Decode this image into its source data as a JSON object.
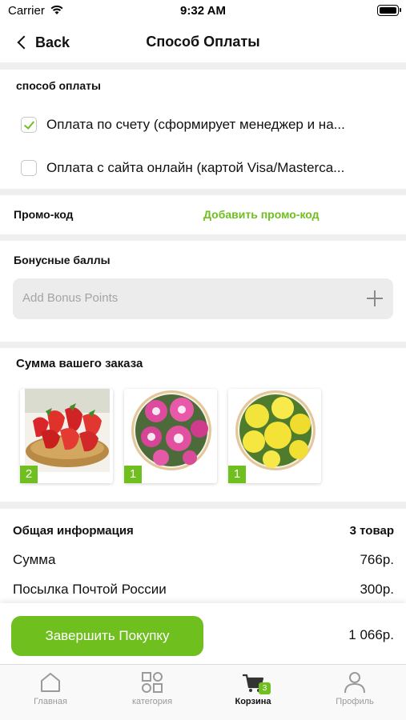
{
  "status_bar": {
    "carrier": "Carrier",
    "time": "9:32 AM"
  },
  "nav": {
    "back_label": "Back",
    "title": "Способ Оплаты"
  },
  "payment": {
    "section_label": "способ оплаты",
    "options": [
      {
        "label": "Оплата по счету (сформирует менеджер и на...",
        "checked": true
      },
      {
        "label": "Оплата с сайта онлайн (картой Visa/Masterca...",
        "checked": false
      }
    ]
  },
  "promo": {
    "label": "Промо-код",
    "link": "Добавить промо-код"
  },
  "bonus": {
    "label": "Бонусные баллы",
    "placeholder": "Add Bonus Points"
  },
  "order": {
    "title": "Сумма вашего заказа",
    "items": [
      {
        "quantity": "2",
        "image": "strawberries"
      },
      {
        "quantity": "1",
        "image": "pink-asters"
      },
      {
        "quantity": "1",
        "image": "yellow-asters"
      }
    ]
  },
  "summary": {
    "title": "Общая информация",
    "count": "3 товар",
    "rows": [
      {
        "label": "Сумма",
        "value": "766р."
      },
      {
        "label": "Посылка Почтой России",
        "value": "300р."
      }
    ]
  },
  "checkout": {
    "button_label": "Завершить Покупку",
    "total": "1 066р."
  },
  "tabbar": {
    "items": [
      {
        "label": "Главная",
        "icon": "home-icon"
      },
      {
        "label": "категория",
        "icon": "category-icon"
      },
      {
        "label": "Корзина",
        "icon": "cart-icon",
        "badge": "3",
        "active": true
      },
      {
        "label": "Профиль",
        "icon": "profile-icon"
      }
    ]
  },
  "colors": {
    "accent": "#6fbf1f",
    "separator": "#efefef",
    "input_bg": "#ececec"
  }
}
